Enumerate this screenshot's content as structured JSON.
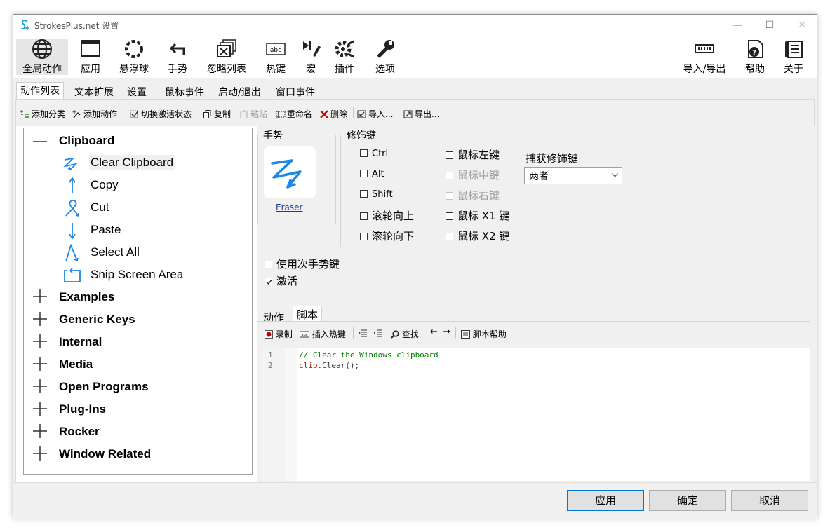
{
  "window": {
    "title": "StrokesPlus.net 设置",
    "minimize": "—",
    "maximize": "☐",
    "close": "✕"
  },
  "toolbar": [
    {
      "label": "全局动作",
      "icon": "globe-icon"
    },
    {
      "label": "应用",
      "icon": "application-window-icon"
    },
    {
      "label": "悬浮球",
      "icon": "hover-ball-icon"
    },
    {
      "label": "手势",
      "icon": "gesture-arrow-icon"
    },
    {
      "label": "忽略列表",
      "icon": "ignore-list-icon"
    },
    {
      "label": "热键",
      "icon": "hotkey-icon"
    },
    {
      "label": "宏",
      "icon": "macro-icon"
    },
    {
      "label": "插件",
      "icon": "plugin-icon"
    },
    {
      "label": "选项",
      "icon": "wrench-icon"
    },
    {
      "label": "导入/导出",
      "icon": "import-export-icon"
    },
    {
      "label": "帮助",
      "icon": "help-icon"
    },
    {
      "label": "关于",
      "icon": "about-icon"
    }
  ],
  "tabs": [
    "动作列表",
    "文本扩展",
    "设置",
    "鼠标事件",
    "启动/退出",
    "窗口事件"
  ],
  "actions": [
    {
      "label": "添加分类",
      "icon": "add-category-icon"
    },
    {
      "label": "添加动作",
      "icon": "add-action-icon"
    },
    {
      "label": "切换激活状态",
      "icon": "toggle-active-icon"
    },
    {
      "label": "复制",
      "icon": "copy-icon"
    },
    {
      "label": "粘贴",
      "icon": "paste-icon"
    },
    {
      "label": "重命名",
      "icon": "rename-icon"
    },
    {
      "label": "删除",
      "icon": "delete-icon"
    },
    {
      "label": "导入...",
      "icon": "import-icon"
    },
    {
      "label": "导出...",
      "icon": "export-icon"
    }
  ],
  "tree": {
    "expanded": {
      "label": "Clipboard",
      "symbol": "—"
    },
    "children": [
      "Clear Clipboard",
      "Copy",
      "Cut",
      "Paste",
      "Select All",
      "Snip Screen Area"
    ],
    "collapsed": [
      "Examples",
      "Generic Keys",
      "Internal",
      "Media",
      "Open Programs",
      "Plug-Ins",
      "Rocker",
      "Window Related"
    ],
    "collapsed_symbol": "+"
  },
  "gesture": {
    "legend": "手势",
    "name": "Eraser"
  },
  "modifiers": {
    "legend": "修饰键",
    "left": [
      "Ctrl",
      "Alt",
      "Shift",
      "滚轮向上",
      "滚轮向下"
    ],
    "right": [
      "鼠标左键",
      "鼠标中键",
      "鼠标右键",
      "鼠标 X1 键",
      "鼠标 X2 键"
    ],
    "capture_label": "捕获修饰键",
    "capture_value": "两者"
  },
  "options": {
    "secondary": "使用次手势键",
    "active": "激活",
    "active_checked": true
  },
  "editor_tabs": [
    "动作",
    "脚本"
  ],
  "editor_toolbar": [
    "录制",
    "插入热键",
    "查找",
    "脚本帮助"
  ],
  "code": {
    "line_numbers": [
      "1",
      "2"
    ],
    "comment": "// Clear the Windows clipboard",
    "obj": "clip",
    "dot": ".",
    "method": "Clear",
    "call": "();"
  },
  "buttons": {
    "apply": "应用",
    "ok": "确定",
    "cancel": "取消"
  },
  "colors": {
    "accent": "#1e88e5",
    "comment": "#008000",
    "keyword": "#a31515",
    "default_border": "#0078d7"
  }
}
